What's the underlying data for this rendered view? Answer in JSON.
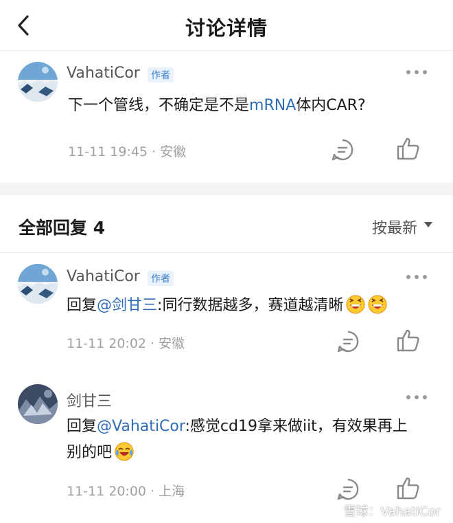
{
  "header": {
    "title": "讨论详情"
  },
  "post": {
    "username": "VahatiCor",
    "author_tag": "作者",
    "text_before": "下一个管线，不确定是不是",
    "link": "mRNA",
    "text_after": "体内CAR?",
    "time": "11-11 19:45",
    "location": "安徽"
  },
  "replies_header": {
    "title": "全部回复 4",
    "sort_label": "按最新"
  },
  "replies": [
    {
      "username": "VahatiCor",
      "author_tag": "作者",
      "prefix": "回复",
      "mention": "@剑甘三",
      "text": ":同行数据越多，赛道越清晰",
      "time": "11-11 20:02",
      "location": "安徽"
    },
    {
      "username": "剑甘三",
      "prefix": "回复",
      "mention": "@VahatiCor",
      "text_line1": ":感觉cd19拿来做iit，有效果再上",
      "text_line2": "别的吧",
      "time": "11-11 20:00",
      "location": "上海"
    }
  ],
  "watermark": "雪球：VahatiCor",
  "colors": {
    "link": "#2f6db5",
    "author_tag_bg": "#e9f2fc",
    "separator": "#f3f4f6"
  },
  "icons": [
    "back-arrow-icon",
    "more-dots-icon",
    "comment-icon",
    "like-thumb-icon",
    "laugh-emoji-icon",
    "cry-laugh-emoji-icon"
  ]
}
